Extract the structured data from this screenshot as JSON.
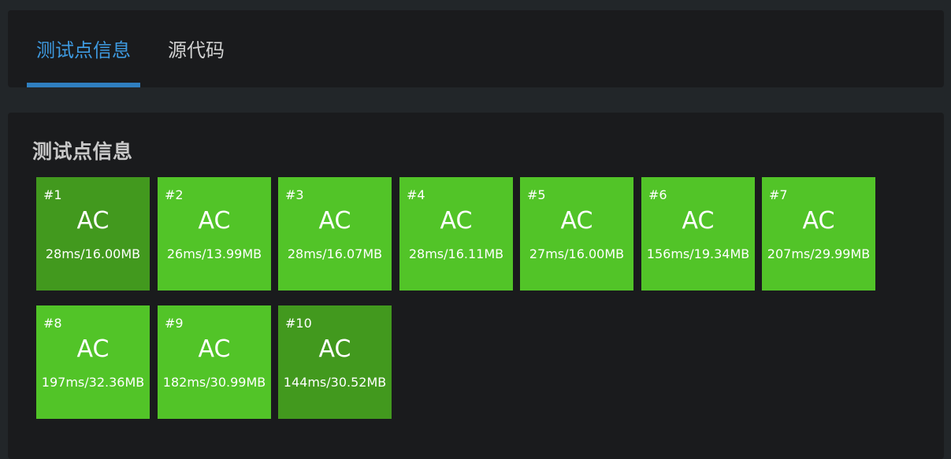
{
  "tabs": {
    "active": "测试点信息",
    "items": [
      "测试点信息",
      "源代码"
    ]
  },
  "section": {
    "title": "测试点信息"
  },
  "colors": {
    "accent": "#3e9ae0",
    "ac_green": "#52c428",
    "ac_green_dark": "#42991e"
  },
  "cases": [
    {
      "num": "#1",
      "status": "AC",
      "detail": "28ms/16.00MB",
      "shade": "dark"
    },
    {
      "num": "#2",
      "status": "AC",
      "detail": "26ms/13.99MB",
      "shade": "light"
    },
    {
      "num": "#3",
      "status": "AC",
      "detail": "28ms/16.07MB",
      "shade": "light"
    },
    {
      "num": "#4",
      "status": "AC",
      "detail": "28ms/16.11MB",
      "shade": "light"
    },
    {
      "num": "#5",
      "status": "AC",
      "detail": "27ms/16.00MB",
      "shade": "light"
    },
    {
      "num": "#6",
      "status": "AC",
      "detail": "156ms/19.34MB",
      "shade": "light"
    },
    {
      "num": "#7",
      "status": "AC",
      "detail": "207ms/29.99MB",
      "shade": "light"
    },
    {
      "num": "#8",
      "status": "AC",
      "detail": "197ms/32.36MB",
      "shade": "light"
    },
    {
      "num": "#9",
      "status": "AC",
      "detail": "182ms/30.99MB",
      "shade": "light"
    },
    {
      "num": "#10",
      "status": "AC",
      "detail": "144ms/30.52MB",
      "shade": "dark"
    }
  ]
}
